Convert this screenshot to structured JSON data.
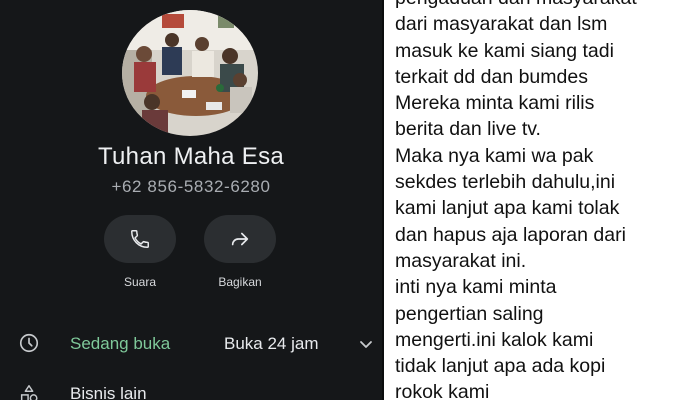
{
  "contact": {
    "name": "Tuhan Maha Esa",
    "phone": "+62 856-5832-6280",
    "avatar_icon": "group-photo-avatar"
  },
  "actions": [
    {
      "label": "Suara",
      "icon": "phone-icon"
    },
    {
      "label": "Bagikan",
      "icon": "share-forward-icon"
    }
  ],
  "hours": {
    "icon": "clock-icon",
    "status": "Sedang buka",
    "status_color": "#7fc99a",
    "text": "Buka 24 jam"
  },
  "other": {
    "icon": "business-icon",
    "label": "Bisnis lain"
  },
  "message": {
    "lines": [
      "pengaduan dari masyarakat",
      "dari masyarakat dan lsm",
      "masuk ke kami siang tadi",
      "terkait dd dan bumdes",
      "Mereka minta kami rilis",
      "berita dan live tv.",
      "Maka nya kami wa pak",
      "sekdes terlebih dahulu,ini",
      "kami lanjut apa kami tolak",
      "dan hapus aja laporan dari",
      "masyarakat ini.",
      "inti nya kami minta",
      "pengertian saling",
      "mengerti.ini kalok kami",
      "tidak lanjut apa ada kopi",
      "rokok kami"
    ]
  }
}
